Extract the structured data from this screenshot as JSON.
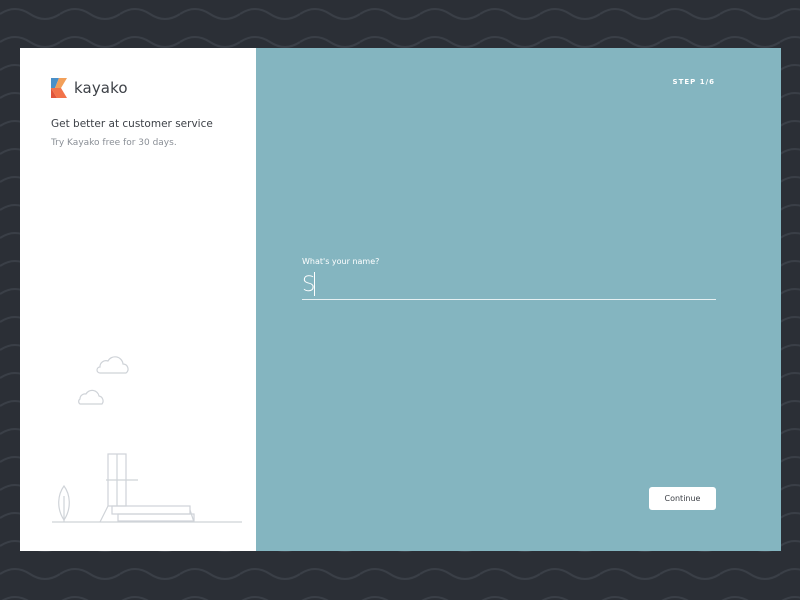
{
  "brand": {
    "name": "kayako",
    "colors": {
      "orange": "#f2734a",
      "blue": "#4a90c8"
    }
  },
  "left_panel": {
    "tagline": "Get better at customer service",
    "subtagline": "Try Kayako free for 30 days."
  },
  "right_panel": {
    "step": "STEP  1/6",
    "name_field": {
      "label": "What's your name?",
      "value": "S"
    },
    "continue_label": "Continue"
  },
  "colors": {
    "background": "#2b2f36",
    "panel_teal": "#84b5c0",
    "panel_white": "#ffffff"
  }
}
